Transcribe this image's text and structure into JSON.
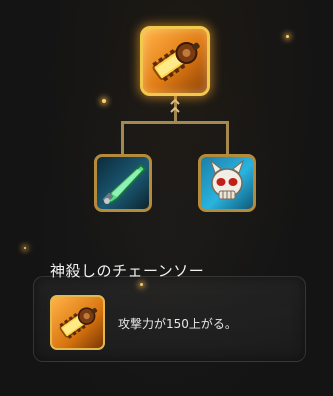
{
  "skill_tree": {
    "top_skill_icon": "chainsaw-icon",
    "left_skill_icon": "blade-icon",
    "right_skill_icon": "demon-skull-icon"
  },
  "detail": {
    "title": "神殺しのチェーンソー",
    "description": "攻撃力が150上がる。",
    "icon": "chainsaw-icon"
  },
  "colors": {
    "gold_frame": "#f2c94c",
    "frame_brown": "#b58a3a",
    "accent_orange": "#e07a14",
    "accent_blue": "#2ab3df",
    "background": "#141414"
  }
}
